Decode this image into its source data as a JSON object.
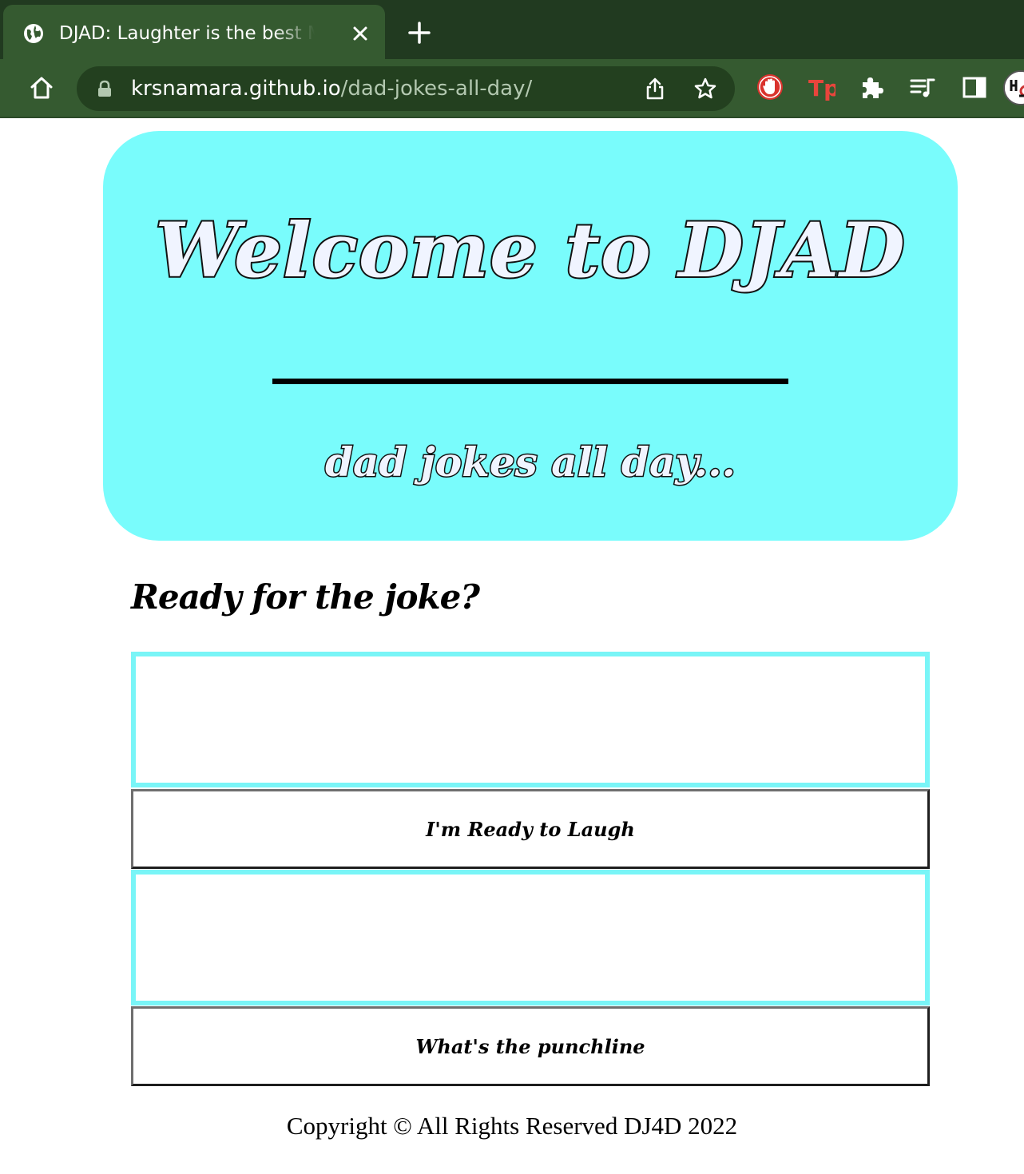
{
  "browser": {
    "tab_title": "DJAD: Laughter is the best Medicine",
    "url_host": "krsnamara.github.io",
    "url_path": "/dad-jokes-all-day/",
    "extensions": [
      "stop-hand-icon",
      "tp-extension-icon",
      "puzzle-icon",
      "media-queue-icon",
      "sidebar-icon"
    ],
    "extension_tp_label": "Tp"
  },
  "hero": {
    "title": "Welcome to DJAD",
    "subtitle": "dad jokes all day...",
    "background_color": "#79fcfc"
  },
  "main": {
    "prompt_heading": "Ready for the joke?",
    "setup_text": "",
    "punchline_text": "",
    "ready_button_label": "I'm Ready to Laugh",
    "punchline_button_label": "What's the punchline"
  },
  "footer": {
    "copyright": "Copyright © All Rights Reserved DJ4D 2022"
  },
  "colors": {
    "accent_cyan": "#79fcfc",
    "box_border": "#79f5f7",
    "chrome_dark": "#213a20",
    "chrome_toolbar": "#355a30"
  }
}
